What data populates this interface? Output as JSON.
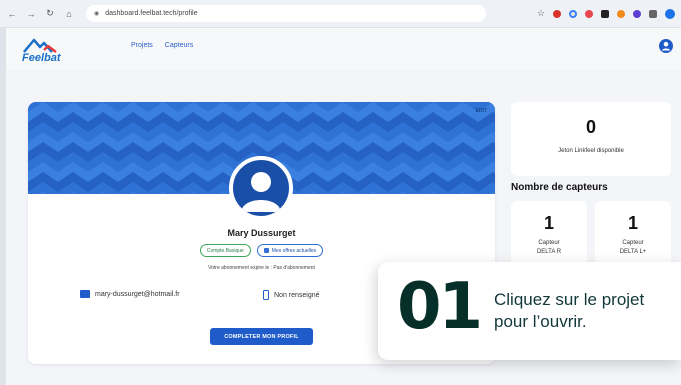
{
  "browser": {
    "url": "dashboard.feelbat.tech/profile"
  },
  "header": {
    "logo_text": "Feelbat",
    "nav": [
      "Projets",
      "Capteurs"
    ]
  },
  "profile": {
    "banner_edit_label": "EDIT",
    "name": "Mary Dussurget",
    "plan_badge": "Compte Basique",
    "offers_badge": "Mes offres actuelles",
    "subscription_line": "Votre abonnement expire le : Pas d'abonnement",
    "email": "mary-dussurget@hotmail.fr",
    "phone": "Non renseigné",
    "complete_button": "COMPLETER MON PROFIL"
  },
  "tokens": {
    "count": "0",
    "label": "Jeton Linkfeel disponible"
  },
  "sensors": {
    "title": "Nombre de capteurs",
    "items": [
      {
        "count": "1",
        "label_line1": "Capteur",
        "label_line2": "DELTA R"
      },
      {
        "count": "1",
        "label_line1": "Capteur",
        "label_line2": "DELTA L+"
      }
    ]
  },
  "tutorial": {
    "step": "01",
    "line1": "Cliquez sur le projet",
    "line2": "pour l’ouvrir."
  },
  "colors": {
    "brand_blue": "#2e6fd4",
    "button_blue": "#1f5cc9",
    "step_dark": "#072f2a"
  }
}
